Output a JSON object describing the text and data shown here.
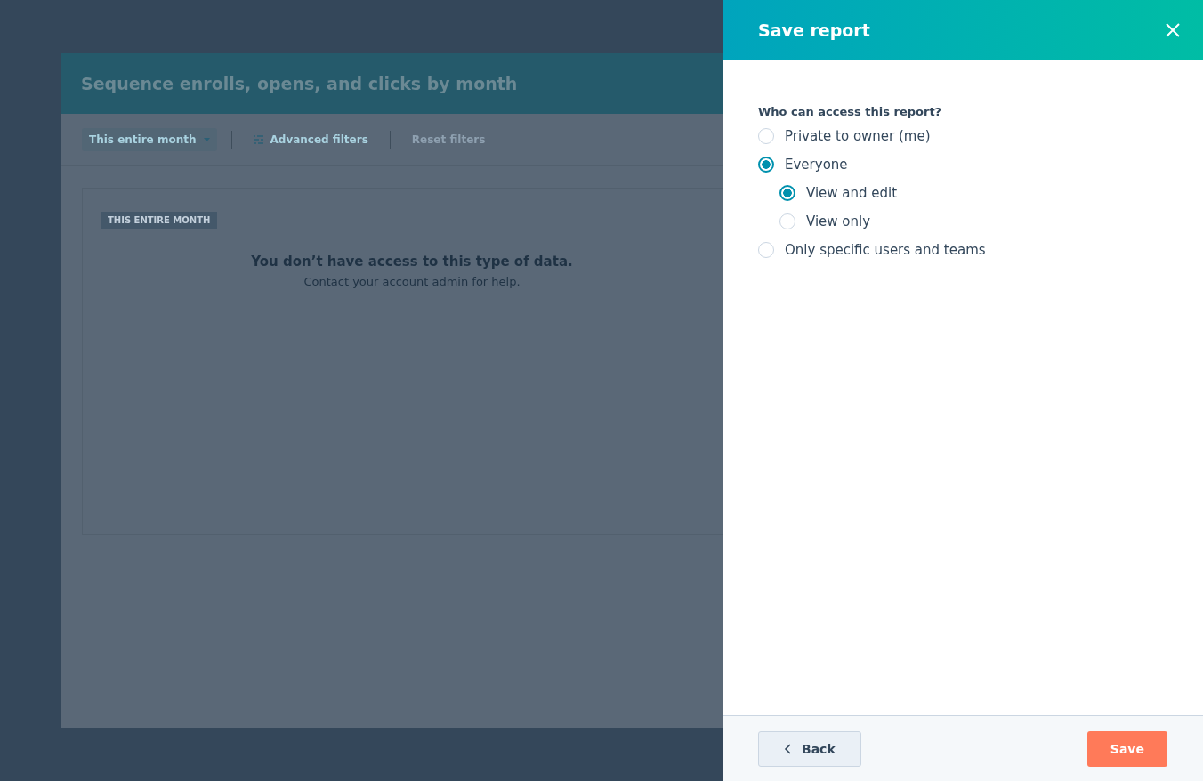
{
  "report": {
    "title": "Sequence enrolls, opens, and clicks by month",
    "filters": [
      {
        "kind": "dropdown",
        "label": "This entire month",
        "disabled": false
      },
      {
        "kind": "advanced",
        "label": "Advanced filters",
        "disabled": false
      },
      {
        "kind": "reset",
        "label": "Reset filters",
        "disabled": true
      }
    ],
    "badge": "THIS ENTIRE MONTH",
    "message": "You don’t have access to this type of data.",
    "hint": "Contact your account admin for help."
  },
  "panel": {
    "title": "Save report",
    "question": "Who can access this report?",
    "options": [
      {
        "label": "Private to owner (me)",
        "selected": false
      },
      {
        "label": "Everyone",
        "selected": true,
        "children": [
          {
            "label": "View and edit",
            "selected": true
          },
          {
            "label": "View only",
            "selected": false
          }
        ]
      },
      {
        "label": "Only specific users and teams",
        "selected": false
      }
    ],
    "back": "Back",
    "save": "Save"
  }
}
